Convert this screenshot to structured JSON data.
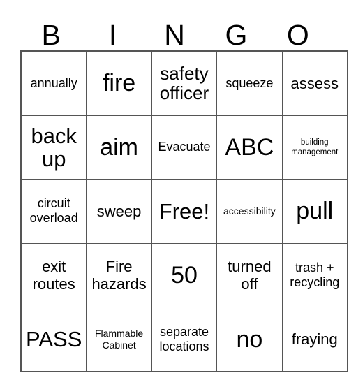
{
  "card": {
    "headers": [
      "B",
      "I",
      "N",
      "G",
      "O"
    ],
    "rows": [
      [
        {
          "text": "annually",
          "size": "fs-sm"
        },
        {
          "text": "fire",
          "size": "fs-xxl"
        },
        {
          "text": "safety officer",
          "size": "fs-lg"
        },
        {
          "text": "squeeze",
          "size": "fs-sm"
        },
        {
          "text": "assess",
          "size": "fs-md"
        }
      ],
      [
        {
          "text": "back up",
          "size": "fs-xl"
        },
        {
          "text": "aim",
          "size": "fs-xxl"
        },
        {
          "text": "Evacuate",
          "size": "fs-sm"
        },
        {
          "text": "ABC",
          "size": "fs-xxl"
        },
        {
          "text": "building management",
          "size": "fs-xxs"
        }
      ],
      [
        {
          "text": "circuit overload",
          "size": "fs-sm"
        },
        {
          "text": "sweep",
          "size": "fs-md"
        },
        {
          "text": "Free!",
          "size": "fs-xl"
        },
        {
          "text": "accessibility",
          "size": "fs-xs"
        },
        {
          "text": "pull",
          "size": "fs-xxl"
        }
      ],
      [
        {
          "text": "exit routes",
          "size": "fs-md"
        },
        {
          "text": "Fire hazards",
          "size": "fs-md"
        },
        {
          "text": "50",
          "size": "fs-xxl"
        },
        {
          "text": "turned off",
          "size": "fs-md"
        },
        {
          "text": "trash + recycling",
          "size": "fs-sm"
        }
      ],
      [
        {
          "text": "PASS",
          "size": "fs-xl"
        },
        {
          "text": "Flammable Cabinet",
          "size": "fs-xs"
        },
        {
          "text": "separate locations",
          "size": "fs-sm"
        },
        {
          "text": "no",
          "size": "fs-xxl"
        },
        {
          "text": "fraying",
          "size": "fs-md"
        }
      ]
    ],
    "free_space_text": "Free!",
    "colors": {
      "border": "#555555",
      "text": "#000000",
      "background": "#ffffff"
    }
  }
}
